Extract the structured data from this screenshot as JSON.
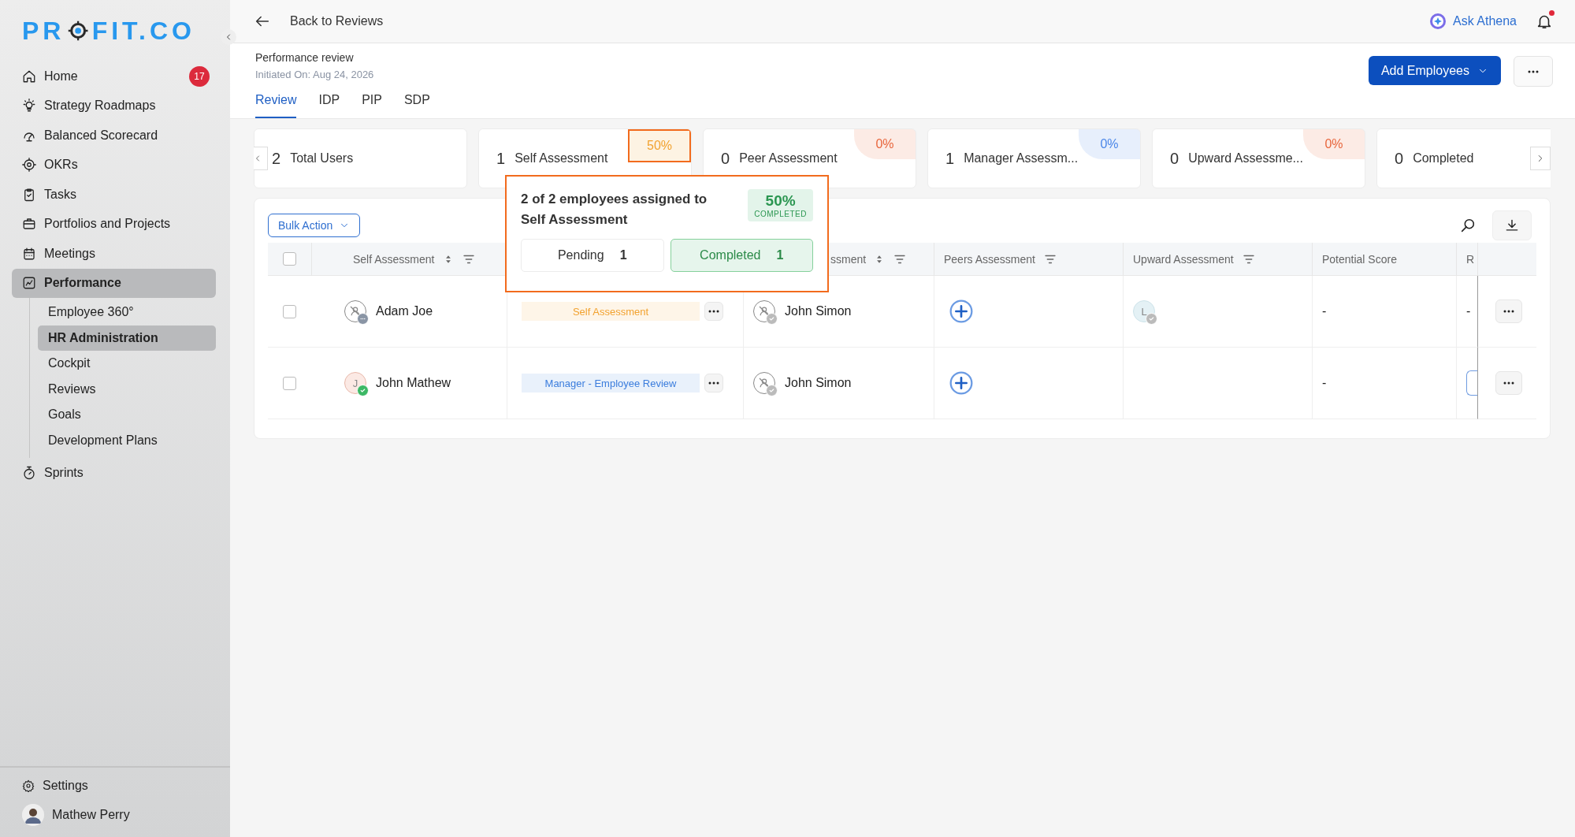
{
  "brand": {
    "logo_start": "PR",
    "logo_end": "FIT.CO"
  },
  "sidebar": {
    "items": [
      {
        "label": "Home",
        "badge": "17",
        "selected": false
      },
      {
        "label": "Strategy Roadmaps",
        "selected": false
      },
      {
        "label": "Balanced Scorecard",
        "selected": false
      },
      {
        "label": "OKRs",
        "selected": false
      },
      {
        "label": "Tasks",
        "selected": false
      },
      {
        "label": "Portfolios and Projects",
        "selected": false
      },
      {
        "label": "Meetings",
        "selected": false
      },
      {
        "label": "Performance",
        "selected": true,
        "expanded": true,
        "children": [
          {
            "label": "Employee 360°",
            "selected": false
          },
          {
            "label": "HR Administration",
            "selected": true
          },
          {
            "label": "Cockpit",
            "selected": false
          },
          {
            "label": "Reviews",
            "selected": false
          },
          {
            "label": "Goals",
            "selected": false
          },
          {
            "label": "Development Plans",
            "selected": false
          }
        ]
      },
      {
        "label": "Sprints",
        "selected": false
      }
    ],
    "settings": "Settings",
    "user": "Mathew Perry"
  },
  "top_bar": {
    "back": "Back to Reviews",
    "assistant": "Ask Athena",
    "notification_unread": true
  },
  "header": {
    "title": "Performance review",
    "initiated": "Initiated On: Aug 24, 2026",
    "primary_button": "Add Employees"
  },
  "tabs": [
    {
      "label": "Review",
      "selected": true
    },
    {
      "label": "IDP",
      "selected": false
    },
    {
      "label": "PIP",
      "selected": false
    },
    {
      "label": "SDP",
      "selected": false
    }
  ],
  "summary_cards": [
    {
      "count": "2",
      "label": "Total Users",
      "highlighted": false
    },
    {
      "count": "1",
      "label": "Self Assessment",
      "percent": "50%",
      "color": "#f2a22f",
      "highlighted": true
    },
    {
      "count": "0",
      "label": "Peer Assessment",
      "percent": "0%",
      "color": "#e8663d",
      "highlighted": false
    },
    {
      "count": "1",
      "label": "Manager Assessm...",
      "percent": "0%",
      "color": "#4a86e8",
      "highlighted": false
    },
    {
      "count": "0",
      "label": "Upward Assessme...",
      "percent": "0%",
      "color": "#e8663d",
      "highlighted": false
    },
    {
      "count": "0",
      "label": "Completed",
      "highlighted": false
    }
  ],
  "popover": {
    "text": "2 of 2 employees assigned to Self Assessment",
    "percent": "50%",
    "percent_label": "COMPLETED",
    "segments": [
      {
        "label": "Pending",
        "count": "1",
        "selected": false
      },
      {
        "label": "Completed",
        "count": "1",
        "selected": true
      }
    ]
  },
  "table": {
    "bulk_action": "Bulk Action",
    "header_checked": false,
    "columns": [
      {
        "label": "Self Assessment",
        "sortable": true,
        "filterable": true
      },
      {
        "label": "ssment",
        "sortable": true,
        "filterable": true
      },
      {
        "label": "Peers Assessment",
        "sortable": false,
        "filterable": true
      },
      {
        "label": "Upward Assessment",
        "sortable": false,
        "filterable": true
      },
      {
        "label": "Potential Score",
        "sortable": false,
        "filterable": false
      },
      {
        "label": "R"
      }
    ],
    "rows": [
      {
        "checked": false,
        "employee": "Adam Joe",
        "employee_completed": false,
        "template": {
          "label": "Self Assessment",
          "color": "#f2a22f"
        },
        "manager": "John Simon",
        "upward_assigned": true,
        "upward_initial": "L",
        "potential": "-",
        "column_7": {
          "kind": "text",
          "text": "-"
        }
      },
      {
        "checked": false,
        "employee": "John Mathew",
        "employee_initial": "J",
        "employee_completed": true,
        "template": {
          "label": "Manager - Employee Review",
          "color": "#3b7ddd"
        },
        "manager": "John Simon",
        "upward_assigned": false,
        "potential": "-",
        "column_7": {
          "kind": "field"
        }
      }
    ]
  }
}
